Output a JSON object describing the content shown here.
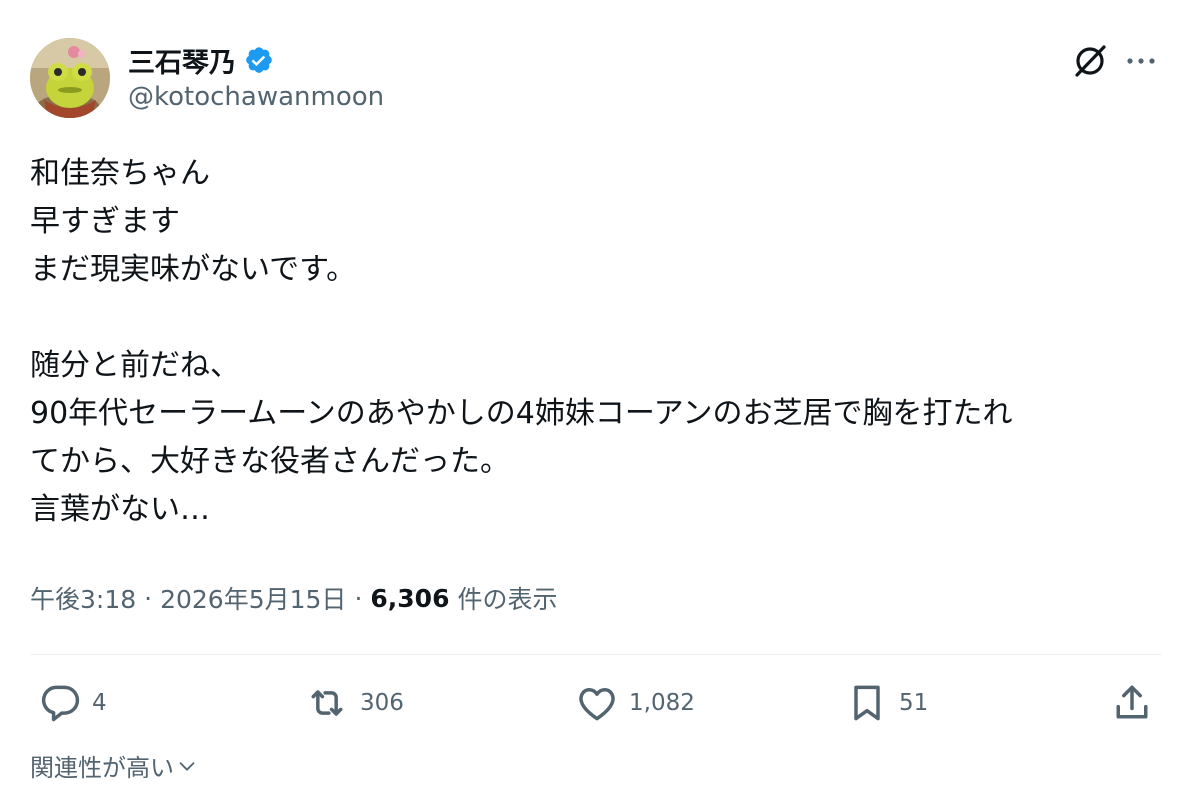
{
  "author": {
    "display_name": "三石琴乃",
    "handle": "@kotochawanmoon",
    "verified": true,
    "avatar_icon": "frog-avatar-icon"
  },
  "header": {
    "grok_icon": "grok-icon",
    "more_icon": "more-icon"
  },
  "tweet": {
    "lines": [
      "和佳奈ちゃん",
      "早すぎます",
      "まだ現実味がないです。",
      "",
      "随分と前だね、",
      "90年代セーラームーンのあやかしの4姉妹コーアンのお芝居で胸を打たれ",
      "てから、大好きな役者さんだった。",
      "言葉がない…"
    ]
  },
  "meta": {
    "time": "午後3:18",
    "separator": "·",
    "date": "2026年5月15日",
    "views_count": "6,306",
    "views_label": "件の表示"
  },
  "actions": {
    "reply_count": "4",
    "retweet_count": "306",
    "like_count": "1,082",
    "bookmark_count": "51"
  },
  "footer": {
    "relevance_label": "関連性が高い",
    "chevron_icon": "chevron-down-icon"
  },
  "colors": {
    "text_primary": "#0f1419",
    "text_secondary": "#536471",
    "verified_blue": "#1d9bf0",
    "divider": "#eff3f4"
  }
}
